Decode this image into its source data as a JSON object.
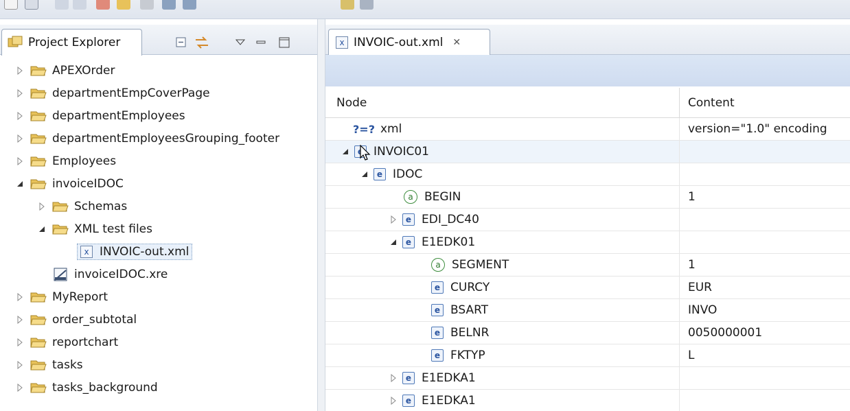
{
  "left_view": {
    "tab_label": "Project Explorer",
    "tree": [
      {
        "label": "APEXOrder",
        "level": 0,
        "expander": "collapsed",
        "icon": "folder-icon"
      },
      {
        "label": "departmentEmpCoverPage",
        "level": 0,
        "expander": "collapsed",
        "icon": "folder-icon"
      },
      {
        "label": "departmentEmployees",
        "level": 0,
        "expander": "collapsed",
        "icon": "folder-icon"
      },
      {
        "label": "departmentEmployeesGrouping_footer",
        "level": 0,
        "expander": "collapsed",
        "icon": "folder-icon"
      },
      {
        "label": "Employees",
        "level": 0,
        "expander": "collapsed",
        "icon": "folder-icon"
      },
      {
        "label": "invoiceIDOC",
        "level": 0,
        "expander": "expanded",
        "icon": "folder-icon"
      },
      {
        "label": "Schemas",
        "level": 1,
        "expander": "collapsed",
        "icon": "folder-icon"
      },
      {
        "label": "XML test files",
        "level": 1,
        "expander": "expanded",
        "icon": "folder-icon"
      },
      {
        "label": "INVOIC-out.xml",
        "level": 2,
        "expander": "none",
        "icon": "xml-file-icon",
        "selected": true
      },
      {
        "label": "invoiceIDOC.xre",
        "level": 1,
        "expander": "none",
        "icon": "report-file-icon"
      },
      {
        "label": "MyReport",
        "level": 0,
        "expander": "collapsed",
        "icon": "folder-icon"
      },
      {
        "label": "order_subtotal",
        "level": 0,
        "expander": "collapsed",
        "icon": "folder-icon"
      },
      {
        "label": "reportchart",
        "level": 0,
        "expander": "collapsed",
        "icon": "folder-icon"
      },
      {
        "label": "tasks",
        "level": 0,
        "expander": "collapsed",
        "icon": "folder-icon"
      },
      {
        "label": "tasks_background",
        "level": 0,
        "expander": "collapsed",
        "icon": "folder-icon"
      }
    ]
  },
  "editor": {
    "tab_label": "INVOIC-out.xml",
    "columns": {
      "node": "Node",
      "content": "Content"
    },
    "rows": [
      {
        "type": "pi",
        "icon_text": "?=?",
        "name": "xml",
        "content": "version=\"1.0\" encoding",
        "level": 0,
        "expander": "none"
      },
      {
        "type": "element",
        "icon_text": "e",
        "name": "INVOIC01",
        "content": "",
        "level": 0,
        "expander": "expanded",
        "hover": true
      },
      {
        "type": "element",
        "icon_text": "e",
        "name": "IDOC",
        "content": "",
        "level": 1,
        "expander": "expanded"
      },
      {
        "type": "attribute",
        "icon_text": "a",
        "name": "BEGIN",
        "content": "1",
        "level": 2,
        "expander": "none"
      },
      {
        "type": "element",
        "icon_text": "e",
        "name": "EDI_DC40",
        "content": "",
        "level": 2,
        "expander": "collapsed"
      },
      {
        "type": "element",
        "icon_text": "e",
        "name": "E1EDK01",
        "content": "",
        "level": 2,
        "expander": "expanded"
      },
      {
        "type": "attribute",
        "icon_text": "a",
        "name": "SEGMENT",
        "content": "1",
        "level": 3,
        "expander": "none"
      },
      {
        "type": "element",
        "icon_text": "e",
        "name": "CURCY",
        "content": "EUR",
        "level": 3,
        "expander": "none"
      },
      {
        "type": "element",
        "icon_text": "e",
        "name": "BSART",
        "content": "INVO",
        "level": 3,
        "expander": "none"
      },
      {
        "type": "element",
        "icon_text": "e",
        "name": "BELNR",
        "content": "0050000001",
        "level": 3,
        "expander": "none"
      },
      {
        "type": "element",
        "icon_text": "e",
        "name": "FKTYP",
        "content": "L",
        "level": 3,
        "expander": "none"
      },
      {
        "type": "element",
        "icon_text": "e",
        "name": "E1EDKA1",
        "content": "",
        "level": 2,
        "expander": "collapsed"
      },
      {
        "type": "element",
        "icon_text": "e",
        "name": "E1EDKA1",
        "content": "",
        "level": 2,
        "expander": "collapsed"
      }
    ]
  },
  "colors": {
    "folder": "#e8c25a",
    "element_icon": "#4f79b8",
    "attribute_icon": "#3f8e3f",
    "header_band": "#d5e1f2"
  }
}
